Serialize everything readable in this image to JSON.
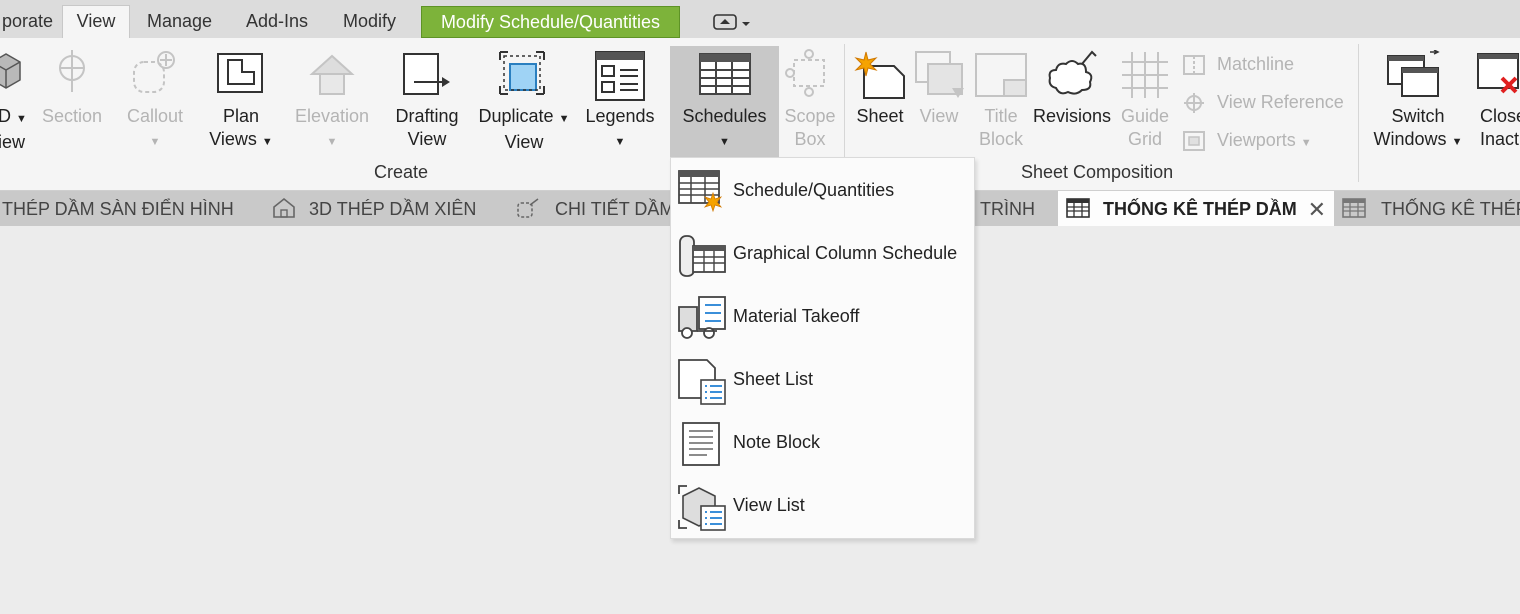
{
  "ribbon_tabs": [
    "porate",
    "View",
    "Manage",
    "Add-Ins",
    "Modify",
    "Modify Schedule/Quantities"
  ],
  "ribbon": {
    "create": {
      "buttons": [
        {
          "line1": "D",
          "line2": "iew"
        },
        {
          "line1": "Section",
          "line2": ""
        },
        {
          "line1": "Callout",
          "line2": ""
        },
        {
          "line1": "Plan",
          "line2": "Views"
        },
        {
          "line1": "Elevation",
          "line2": ""
        },
        {
          "line1": "Drafting",
          "line2": "View"
        },
        {
          "line1": "Duplicate",
          "line2": "View"
        },
        {
          "line1": "Legends",
          "line2": ""
        },
        {
          "line1": "Schedules",
          "line2": ""
        },
        {
          "line1": "Scope",
          "line2": "Box"
        }
      ],
      "label": "Create"
    },
    "sheet_composition": {
      "buttons": [
        {
          "line1": "Sheet",
          "line2": ""
        },
        {
          "line1": "View",
          "line2": ""
        },
        {
          "line1": "Title",
          "line2": "Block"
        },
        {
          "line1": "Revisions",
          "line2": ""
        },
        {
          "line1": "Guide",
          "line2": "Grid"
        }
      ],
      "small": [
        "Matchline",
        "View  Reference",
        "Viewports"
      ],
      "label": "Sheet Composition"
    },
    "windows": {
      "buttons": [
        {
          "line1": "Switch",
          "line2": "Windows"
        },
        {
          "line1": "Close",
          "line2": "Inactiv"
        }
      ]
    }
  },
  "view_tabs": [
    "THÉP DẦM SÀN ĐIỂN HÌNH",
    "3D THÉP DẦM XIÊN",
    "CHI TIẾT DẦM",
    "TRÌNH",
    "THỐNG KÊ THÉP DẦM",
    "THỐNG KÊ THÉP"
  ],
  "schedules_menu": [
    "Schedule/Quantities",
    "Graphical Column Schedule",
    "Material Takeoff",
    "Sheet List",
    "Note Block",
    "View List"
  ],
  "colors": {
    "contextual_tab": "#7db33a",
    "highlight": "#c8c8c8",
    "accent_blue": "#3b8fd9",
    "accent_orange": "#f5a300"
  }
}
